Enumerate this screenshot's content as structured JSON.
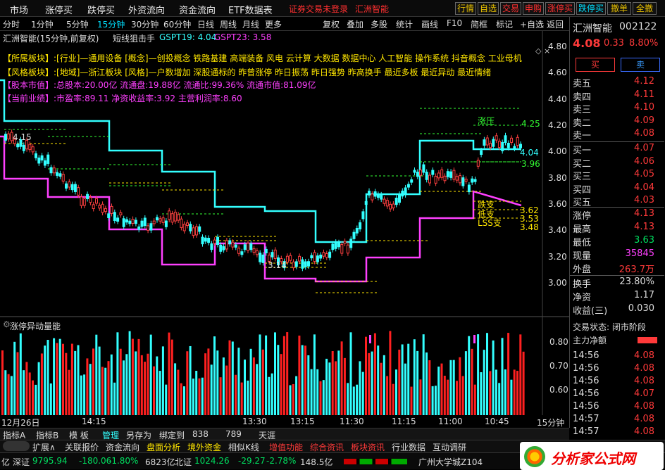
{
  "menubar": {
    "items": [
      "市场",
      "涨停买",
      "跌停买",
      "外资流向",
      "资金流向",
      "ETF数据表"
    ],
    "login": "证券交易未登录",
    "stock": "汇洲智能",
    "right_buttons": [
      "行情",
      "自选",
      "交易",
      "申购",
      "涨停买",
      "跌停买",
      "撤单",
      "全撤"
    ]
  },
  "periods": [
    "分时",
    "1分钟",
    "5分钟",
    "15分钟",
    "30分钟",
    "60分钟",
    "日线",
    "周线",
    "月线",
    "更多"
  ],
  "active_period": "15分钟",
  "tools": [
    "复权",
    "叠加",
    "多股",
    "统计",
    "画线",
    "F10",
    "简框",
    "标记",
    "+自选",
    "返回"
  ],
  "chart": {
    "title": "汇洲智能(15分钟,前复权)",
    "indicator": "短线狙击手",
    "gspt19": "GSPT19: 4.04",
    "gspt23": "GSPT23: 3.58",
    "info_lines": [
      "【所属板块】:[行业]—通用设备 [概念]—创投概念 铁路基建 高端装备 风电 云计算 大数据 数据中心 人工智能 操作系统 抖音概念 工业母机",
      "【风格板块】:[地域]—浙江板块 [风格]—户数增加 深股通标的 昨曾涨停 昨日振荡 昨日强势 昨高换手 最近多板 最近异动 最近情绪",
      "【股本市值】:总股本:20.00亿 流通盘:19.88亿 流通比:99.36% 流通市值:81.09亿",
      "【当前业绩】:市盈率:89.11 净资收益率:3.92 主营利润率:8.60"
    ],
    "labels": {
      "zhangya": "涨压",
      "diaoya": "跌支",
      "diya": "低支",
      "lss": "LSS支",
      "high_note": "4.15",
      "low_note": "3.14"
    },
    "levels": [
      "4.25",
      "4.04",
      "3.96",
      "3.62",
      "3.53",
      "3.48"
    ],
    "y_axis": [
      "4.80",
      "4.60",
      "4.40",
      "4.20",
      "4.00",
      "3.80",
      "3.60",
      "3.40",
      "3.20",
      "3.00"
    ],
    "sub_title": "涨停异动量能",
    "sub_axis": [
      "0.80",
      "0.70",
      "0.60"
    ],
    "x_axis": [
      "12月26日",
      "14:15",
      "13:30",
      "13:15",
      "11:30",
      "11:15",
      "11:00",
      "10:45"
    ],
    "x_end": "15分钟"
  },
  "quote": {
    "name": "汇洲智能",
    "code": "002122",
    "price": "4.08",
    "chg": "0.33",
    "pct": "8.80%",
    "buy": "买",
    "sell": "卖",
    "asks": [
      {
        "l": "卖五",
        "p": "4.12"
      },
      {
        "l": "卖四",
        "p": "4.11"
      },
      {
        "l": "卖三",
        "p": "4.10"
      },
      {
        "l": "卖二",
        "p": "4.09"
      },
      {
        "l": "卖一",
        "p": "4.08"
      }
    ],
    "bids": [
      {
        "l": "买一",
        "p": "4.07"
      },
      {
        "l": "买二",
        "p": "4.06"
      },
      {
        "l": "买三",
        "p": "4.05"
      },
      {
        "l": "买四",
        "p": "4.04"
      },
      {
        "l": "买五",
        "p": "4.03"
      }
    ],
    "stats": [
      {
        "l": "涨停",
        "v": "4.13"
      },
      {
        "l": "最高",
        "v": "4.13"
      },
      {
        "l": "最低",
        "v": "3.63"
      },
      {
        "l": "现量",
        "v": "35845"
      },
      {
        "l": "外盘",
        "v": "263.7万"
      }
    ],
    "stats2": [
      {
        "l": "换手",
        "v": "23.80%"
      },
      {
        "l": "净资",
        "v": "1.17"
      },
      {
        "l": "收益(三)",
        "v": "0.030"
      }
    ],
    "trade_state": "交易状态: 闭市阶段",
    "netflow": "主力净额",
    "ticks": [
      {
        "t": "14:56",
        "p": "4.08"
      },
      {
        "t": "14:56",
        "p": "4.08"
      },
      {
        "t": "14:56",
        "p": "4.08"
      },
      {
        "t": "14:56",
        "p": "4.07"
      },
      {
        "t": "14:56",
        "p": "4.08"
      },
      {
        "t": "14:57",
        "p": "4.08"
      },
      {
        "t": "14:57",
        "p": "4.08"
      }
    ]
  },
  "bottom1": [
    "指标A",
    "指标B",
    "模 板",
    "管理",
    "另存为",
    "绑定到",
    "838",
    "789",
    "天涯"
  ],
  "bottom2": [
    "扩展∧",
    "关联报价",
    "资金流向",
    "盘面分析",
    "境外资金",
    "相似K线",
    "增值功能",
    "综合资讯",
    "板块资讯",
    "行业数据",
    "互动调研"
  ],
  "bottom3": {
    "idx1": "亿",
    "sz": "深证",
    "sz_v": "9795.94",
    "sz_c": "-180.06",
    "sz_p": "-1.80%",
    "sz_a": "6823亿",
    "bz": "北证",
    "bz_v": "1024.26",
    "bz_c": "-29.27",
    "bz_p": "-2.78%",
    "bz_a": "148.5亿",
    "loc": "广州大学城Z104",
    "logo": "分析家公式网"
  }
}
